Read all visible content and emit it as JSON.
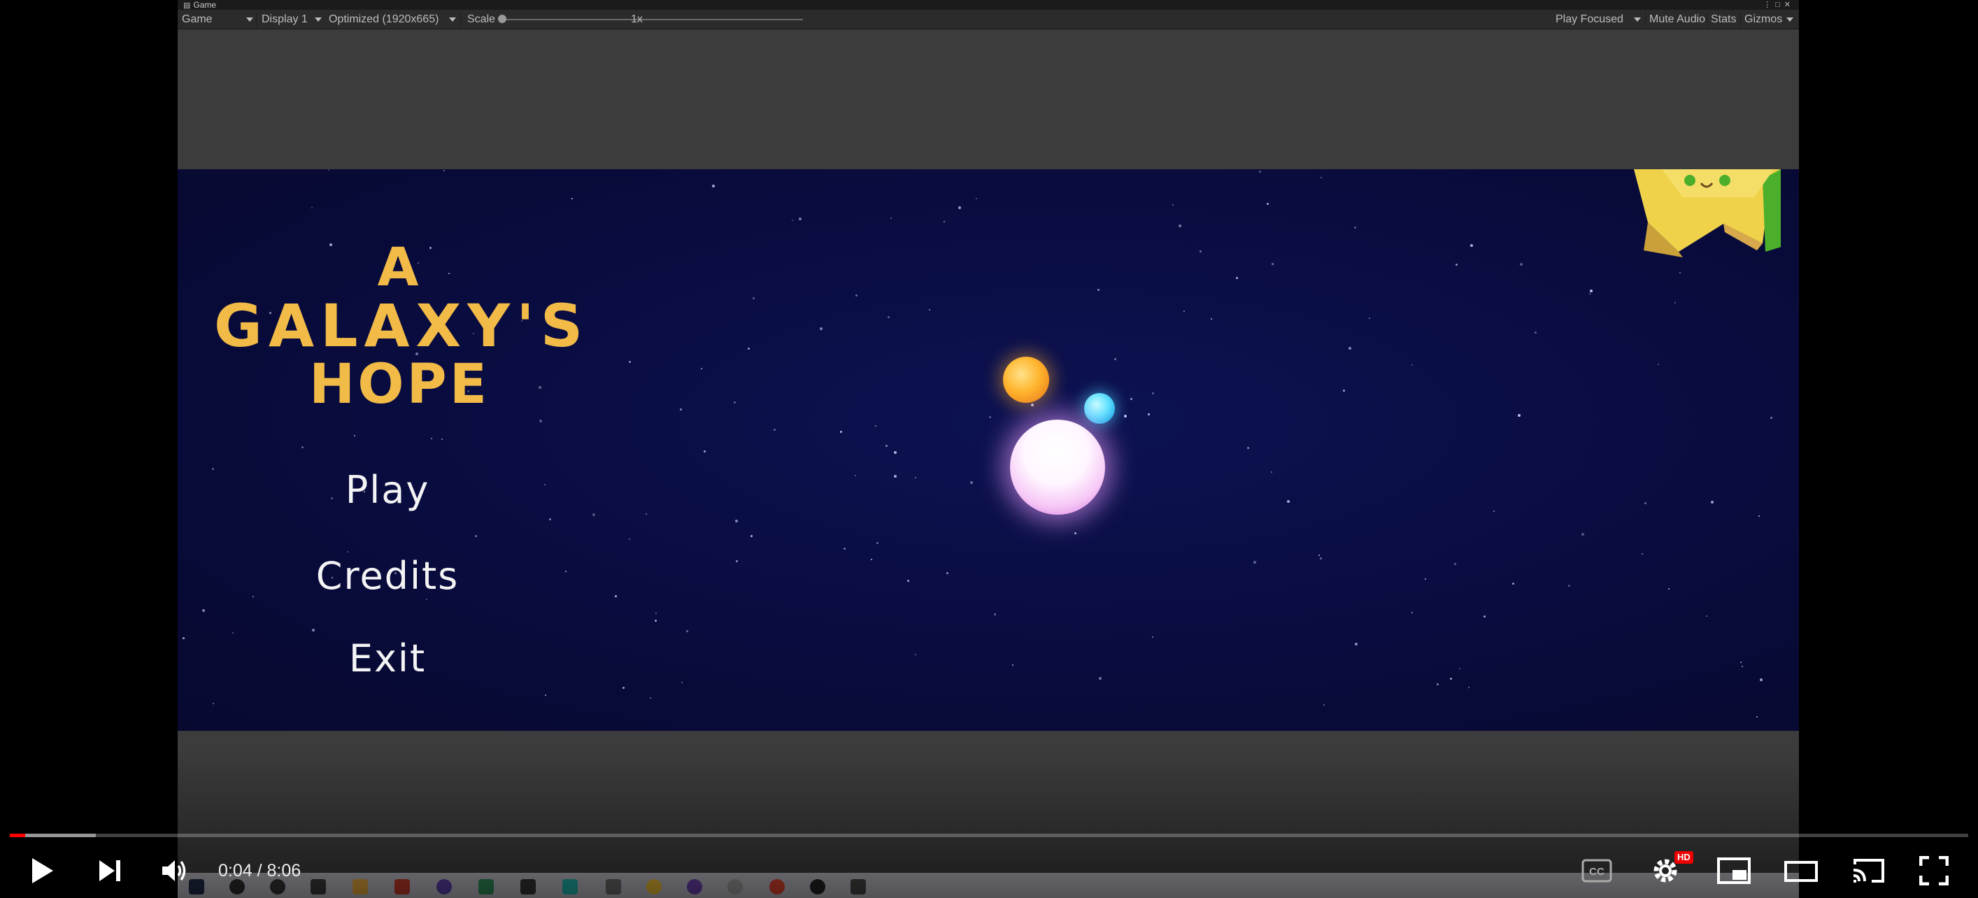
{
  "unity": {
    "window_tab_label": "Game",
    "toolbar": {
      "view_dropdown": "Game",
      "display_dropdown": "Display 1",
      "resolution_dropdown": "Optimized (1920x665)",
      "scale_label": "Scale",
      "scale_value": "1x",
      "play_mode_dropdown": "Play Focused",
      "mute_audio_label": "Mute Audio",
      "stats_label": "Stats",
      "gizmos_label": "Gizmos"
    }
  },
  "game": {
    "title_line1": "A",
    "title_line2": "GALAXY'S",
    "title_line3": "HOPE",
    "menu": {
      "play": "Play",
      "credits": "Credits",
      "exit": "Exit"
    },
    "colors": {
      "title": "#f2bb48",
      "background": "#090c3e"
    }
  },
  "player": {
    "current_time": "0:04",
    "duration": "8:06",
    "time_display": "0:04 / 8:06",
    "played_fraction": 0.008,
    "buffered_fraction": 0.044,
    "quality_badge": "HD",
    "controls": {
      "play_icon": "play-icon",
      "next_icon": "next-icon",
      "volume_icon": "volume-icon",
      "captions_icon": "captions-icon",
      "settings_icon": "settings-icon",
      "miniplayer_icon": "miniplayer-icon",
      "theater_icon": "theater-icon",
      "cast_icon": "cast-icon",
      "fullscreen_icon": "fullscreen-icon"
    }
  }
}
